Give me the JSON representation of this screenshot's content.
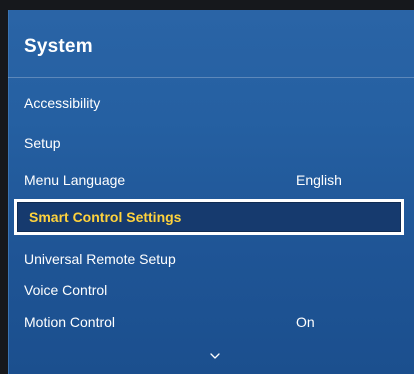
{
  "menu": {
    "title": "System",
    "items": [
      {
        "label": "Accessibility",
        "value": ""
      },
      {
        "label": "Setup",
        "value": ""
      },
      {
        "label": "Menu Language",
        "value": "English"
      },
      {
        "label": "Smart Control Settings",
        "value": "",
        "selected": true
      },
      {
        "label": "Universal Remote Setup",
        "value": ""
      },
      {
        "label": "Voice Control",
        "value": ""
      },
      {
        "label": "Motion Control",
        "value": "On"
      }
    ],
    "more_indicator": "chevron-down-icon"
  },
  "colors": {
    "panel": "#2560a2",
    "highlight_text": "#ffd23c",
    "text": "#ffffff"
  }
}
